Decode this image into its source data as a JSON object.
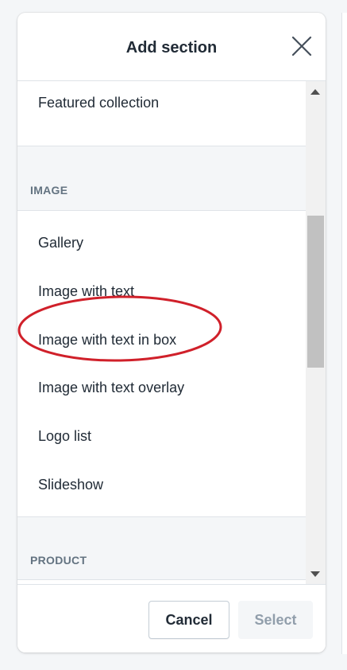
{
  "dialog": {
    "title": "Add section",
    "close_icon": "close-icon"
  },
  "sections": {
    "featured": {
      "items": [
        "Featured collection"
      ]
    },
    "image": {
      "label": "IMAGE",
      "items": [
        "Gallery",
        "Image with text",
        "Image with text in box",
        "Image with text overlay",
        "Logo list",
        "Slideshow"
      ]
    },
    "product": {
      "label": "PRODUCT"
    }
  },
  "footer": {
    "cancel_label": "Cancel",
    "select_label": "Select"
  },
  "colors": {
    "annotation_circle": "#d0202a",
    "disabled_text": "#919eab",
    "border": "#dfe3e8"
  }
}
